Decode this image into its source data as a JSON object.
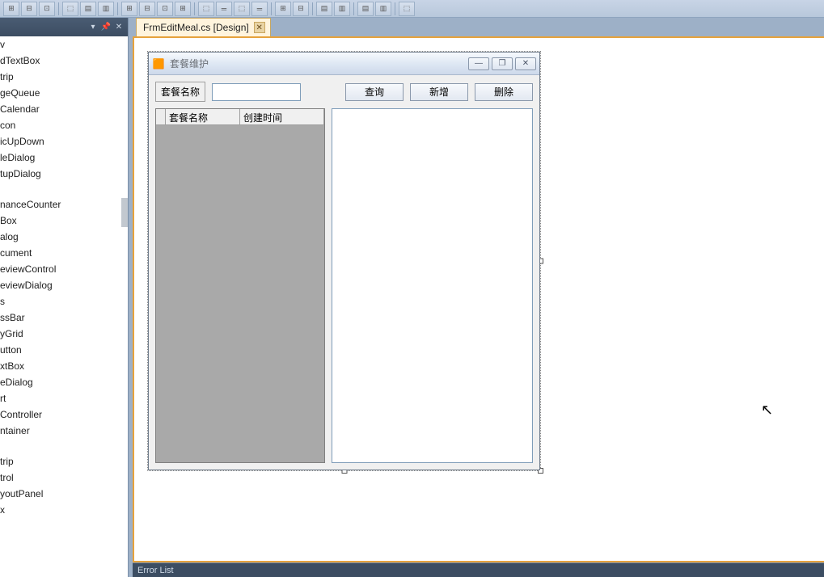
{
  "toolbar_icons": [
    "⊞",
    "⊟",
    "⊡",
    "⊞",
    "⬚",
    "⊞",
    "⊡",
    "⬚",
    "⬚",
    "═",
    "⬚",
    "═",
    "⊞",
    "⊟",
    "⊡",
    "⊞",
    "⬚",
    "⊞",
    "⊡",
    "⬚",
    "⬚",
    "═",
    "⬚",
    "═",
    "▤",
    "▥",
    "⬚"
  ],
  "toolbox": {
    "header_icons": [
      "▾",
      "📌",
      "✕"
    ],
    "items": [
      "v",
      "dTextBox",
      "trip",
      "geQueue",
      "Calendar",
      "con",
      "icUpDown",
      "leDialog",
      "tupDialog",
      "",
      "nanceCounter",
      "Box",
      "alog",
      "cument",
      "eviewControl",
      "eviewDialog",
      "s",
      "ssBar",
      "yGrid",
      "utton",
      "xtBox",
      "eDialog",
      "rt",
      "Controller",
      "ntainer",
      "",
      "trip",
      "trol",
      "youtPanel",
      "x",
      "",
      ""
    ]
  },
  "tab": {
    "label": "FrmEditMeal.cs [Design]"
  },
  "winform": {
    "title": "套餐维护",
    "min": "—",
    "max": "❐",
    "close": "✕",
    "search_label": "套餐名称",
    "search_value": "",
    "buttons": {
      "query": "查询",
      "add": "新增",
      "delete": "删除"
    },
    "grid_cols": [
      "套餐名称",
      "创建时间"
    ]
  },
  "bottom": {
    "error_list": "Error List"
  }
}
